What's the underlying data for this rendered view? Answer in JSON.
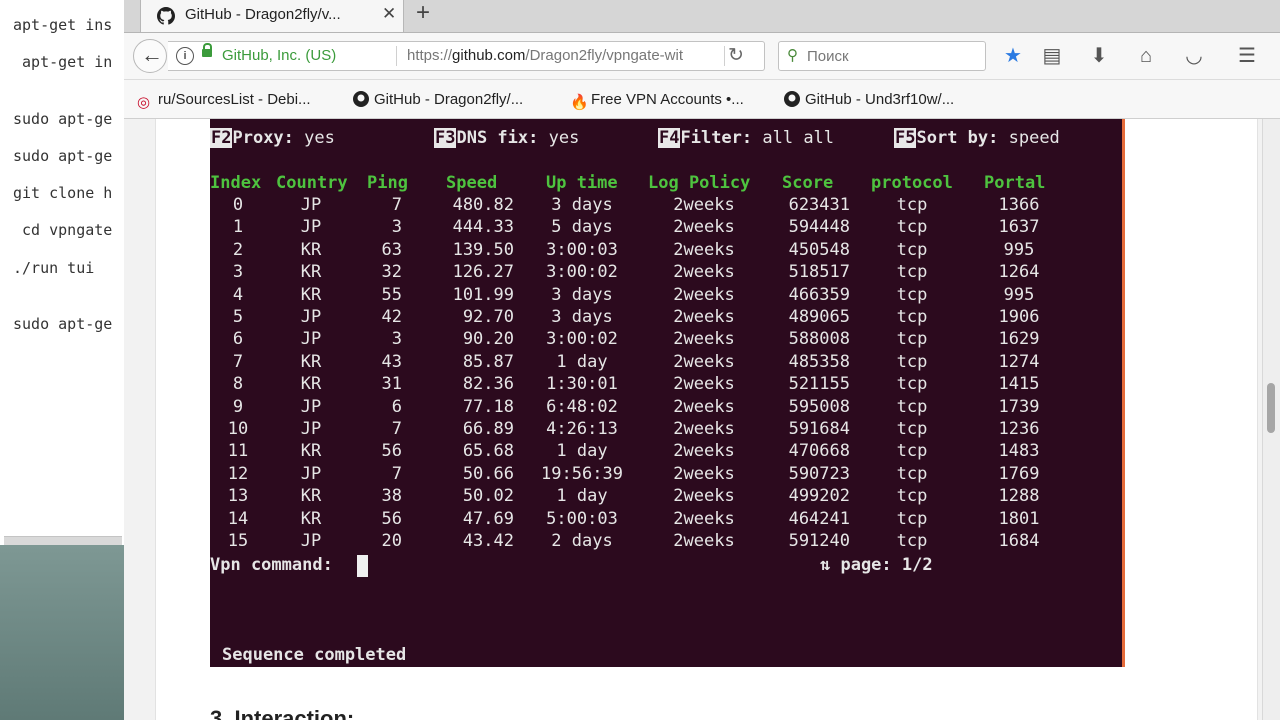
{
  "background_terminal": {
    "lines": [
      "apt-get ins",
      " apt-get in",
      "sudo apt-ge",
      "sudo apt-ge",
      "git clone h",
      " cd vpngate",
      "./run tui",
      "sudo apt-ge"
    ]
  },
  "browser": {
    "tab_title": "GitHub - Dragon2fly/v...",
    "tab_close": "✕",
    "new_tab": "+",
    "identity": "GitHub, Inc. (US)",
    "url_prefix": "https://",
    "url_host": "github.com",
    "url_path": "/Dragon2fly/vpngate-wit",
    "search_placeholder": "Поиск",
    "bookmarks": [
      "ru/SourcesList - Debi...",
      "GitHub - Dragon2fly/...",
      "Free VPN Accounts •...",
      "GitHub - Und3rf10w/..."
    ]
  },
  "terminal": {
    "fkeys": [
      {
        "key": "F2",
        "label": "Proxy:",
        "value": " yes"
      },
      {
        "key": "F3",
        "label": "DNS fix:",
        "value": " yes"
      },
      {
        "key": "F4",
        "label": "Filter:",
        "value": " all all"
      },
      {
        "key": "F5",
        "label": "Sort by:",
        "value": " speed"
      }
    ],
    "columns": [
      "Index",
      "Country",
      "Ping",
      "Speed",
      "Up time",
      "Log Policy",
      "Score",
      "protocol",
      "Portal"
    ],
    "rows": [
      [
        "0",
        "JP",
        "7",
        "480.82",
        "3 days",
        "2weeks",
        "623431",
        "tcp",
        "1366"
      ],
      [
        "1",
        "JP",
        "3",
        "444.33",
        "5 days",
        "2weeks",
        "594448",
        "tcp",
        "1637"
      ],
      [
        "2",
        "KR",
        "63",
        "139.50",
        "3:00:03",
        "2weeks",
        "450548",
        "tcp",
        "995"
      ],
      [
        "3",
        "KR",
        "32",
        "126.27",
        "3:00:02",
        "2weeks",
        "518517",
        "tcp",
        "1264"
      ],
      [
        "4",
        "KR",
        "55",
        "101.99",
        "3 days",
        "2weeks",
        "466359",
        "tcp",
        "995"
      ],
      [
        "5",
        "JP",
        "42",
        "92.70",
        "3 days",
        "2weeks",
        "489065",
        "tcp",
        "1906"
      ],
      [
        "6",
        "JP",
        "3",
        "90.20",
        "3:00:02",
        "2weeks",
        "588008",
        "tcp",
        "1629"
      ],
      [
        "7",
        "KR",
        "43",
        "85.87",
        "1 day",
        "2weeks",
        "485358",
        "tcp",
        "1274"
      ],
      [
        "8",
        "KR",
        "31",
        "82.36",
        "1:30:01",
        "2weeks",
        "521155",
        "tcp",
        "1415"
      ],
      [
        "9",
        "JP",
        "6",
        "77.18",
        "6:48:02",
        "2weeks",
        "595008",
        "tcp",
        "1739"
      ],
      [
        "10",
        "JP",
        "7",
        "66.89",
        "4:26:13",
        "2weeks",
        "591684",
        "tcp",
        "1236"
      ],
      [
        "11",
        "KR",
        "56",
        "65.68",
        "1 day",
        "2weeks",
        "470668",
        "tcp",
        "1483"
      ],
      [
        "12",
        "JP",
        "7",
        "50.66",
        "19:56:39",
        "2weeks",
        "590723",
        "tcp",
        "1769"
      ],
      [
        "13",
        "KR",
        "38",
        "50.02",
        "1 day",
        "2weeks",
        "499202",
        "tcp",
        "1288"
      ],
      [
        "14",
        "KR",
        "56",
        "47.69",
        "5:00:03",
        "2weeks",
        "464241",
        "tcp",
        "1801"
      ],
      [
        "15",
        "JP",
        "20",
        "43.42",
        "2 days",
        "2weeks",
        "591240",
        "tcp",
        "1684"
      ]
    ],
    "prompt": "Vpn command:",
    "page_info": "⇅ page: 1/2",
    "status": "Sequence completed"
  },
  "page": {
    "next_heading": "3. Interaction:"
  },
  "colors": {
    "terminal_bg": "#2c0a1e",
    "header_green": "#4ec33f",
    "accent_orange": "#e56b3a",
    "secure_green": "#3b9b3b"
  }
}
